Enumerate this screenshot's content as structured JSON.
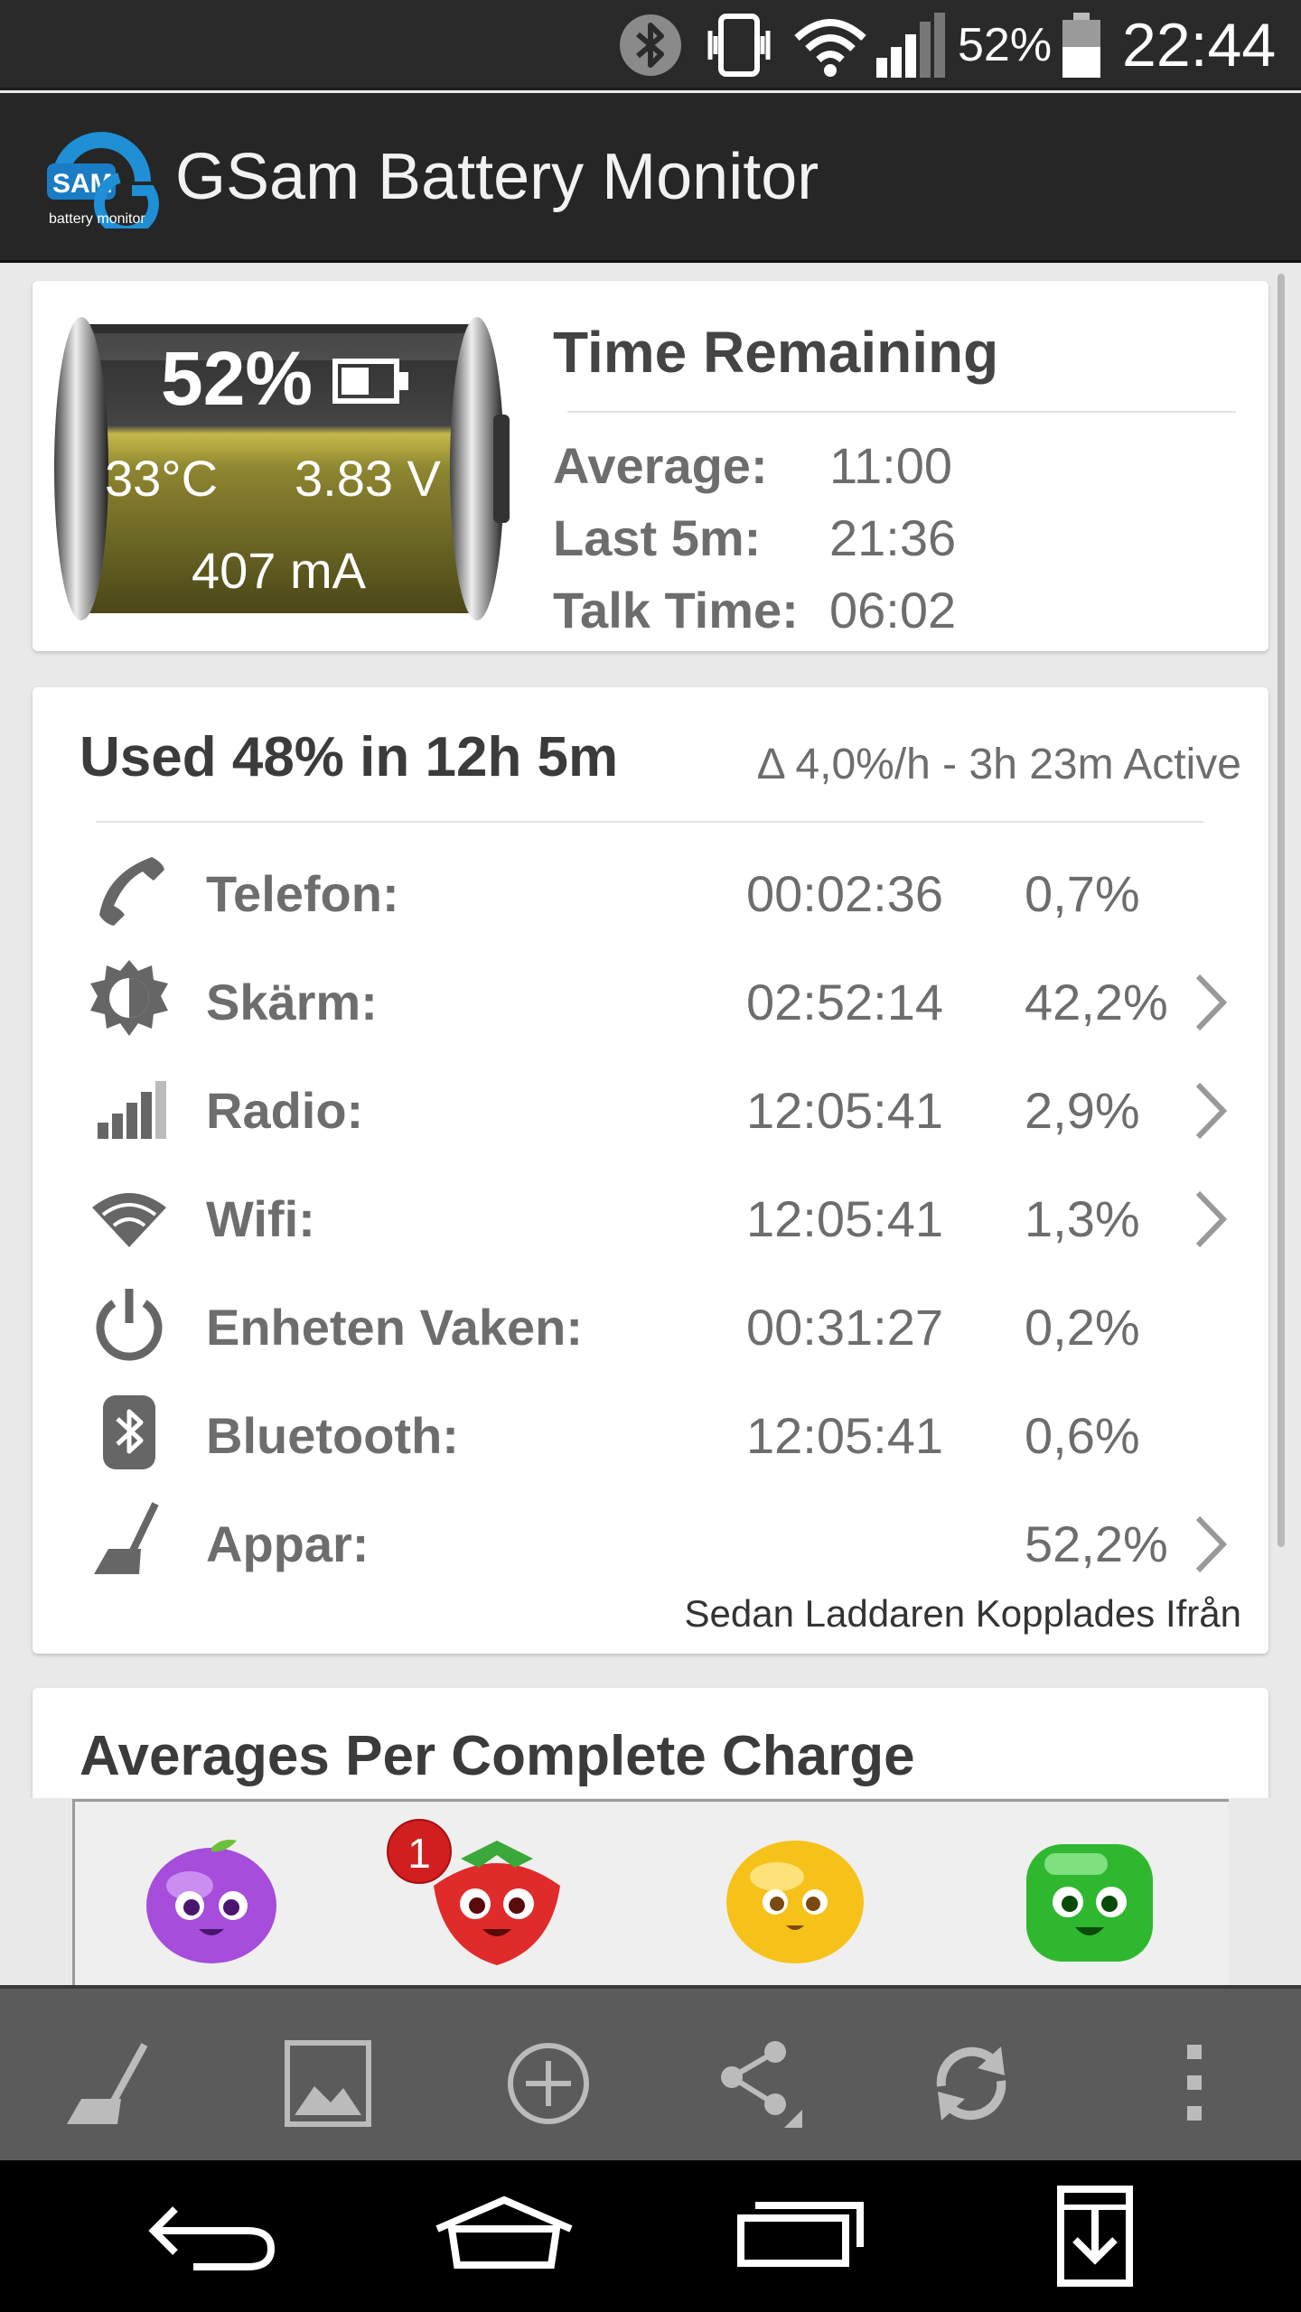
{
  "status_bar": {
    "battery_percent": "52%",
    "time": "22:44",
    "icons": [
      "bluetooth-icon",
      "vibrate-icon",
      "wifi-icon",
      "signal-icon",
      "battery-icon"
    ]
  },
  "app_bar": {
    "title": "GSam Battery Monitor",
    "logo_text": "SAM",
    "logo_subtext": "battery monitor"
  },
  "battery_card": {
    "percent": "52%",
    "temperature": "33°C",
    "voltage": "3.83 V",
    "current": "407 mA",
    "time_remaining_title": "Time Remaining",
    "rows": [
      {
        "label": "Average:",
        "value": "11:00"
      },
      {
        "label": "Last 5m:",
        "value": "21:36"
      },
      {
        "label": "Talk Time:",
        "value": "06:02"
      }
    ]
  },
  "usage_card": {
    "title": "Used 48% in 12h 5m",
    "rate": "Δ 4,0%/h - 3h 23m Active",
    "rows": [
      {
        "icon": "phone-icon",
        "label": "Telefon:",
        "time": "00:02:36",
        "percent": "0,7%",
        "chevron": false
      },
      {
        "icon": "brightness-icon",
        "label": "Skärm:",
        "time": "02:52:14",
        "percent": "42,2%",
        "chevron": true
      },
      {
        "icon": "signal-bars-icon",
        "label": "Radio:",
        "time": "12:05:41",
        "percent": "2,9%",
        "chevron": true
      },
      {
        "icon": "wifi-icon",
        "label": "Wifi:",
        "time": "12:05:41",
        "percent": "1,3%",
        "chevron": true
      },
      {
        "icon": "power-icon",
        "label": "Enheten Vaken:",
        "time": "00:31:27",
        "percent": "0,2%",
        "chevron": false
      },
      {
        "icon": "bluetooth-icon",
        "label": "Bluetooth:",
        "time": "12:05:41",
        "percent": "0,6%",
        "chevron": false
      },
      {
        "icon": "broom-icon",
        "label": "Appar:",
        "time": "",
        "percent": "52,2%",
        "chevron": true
      }
    ],
    "footer": "Sedan Laddaren Kopplades Ifrån"
  },
  "averages_card": {
    "title": "Averages Per Complete Charge"
  },
  "ad_banner": {
    "badge_count": "1",
    "items": [
      "purple-fruit-icon",
      "strawberry-icon",
      "lemon-icon",
      "green-fruit-icon"
    ]
  },
  "toolbar": {
    "items": [
      "broom-icon",
      "image-icon",
      "add-icon",
      "share-icon",
      "refresh-icon",
      "more-icon"
    ]
  },
  "nav_bar": {
    "items": [
      "back-icon",
      "home-icon",
      "recent-apps-icon",
      "download-icon"
    ]
  }
}
